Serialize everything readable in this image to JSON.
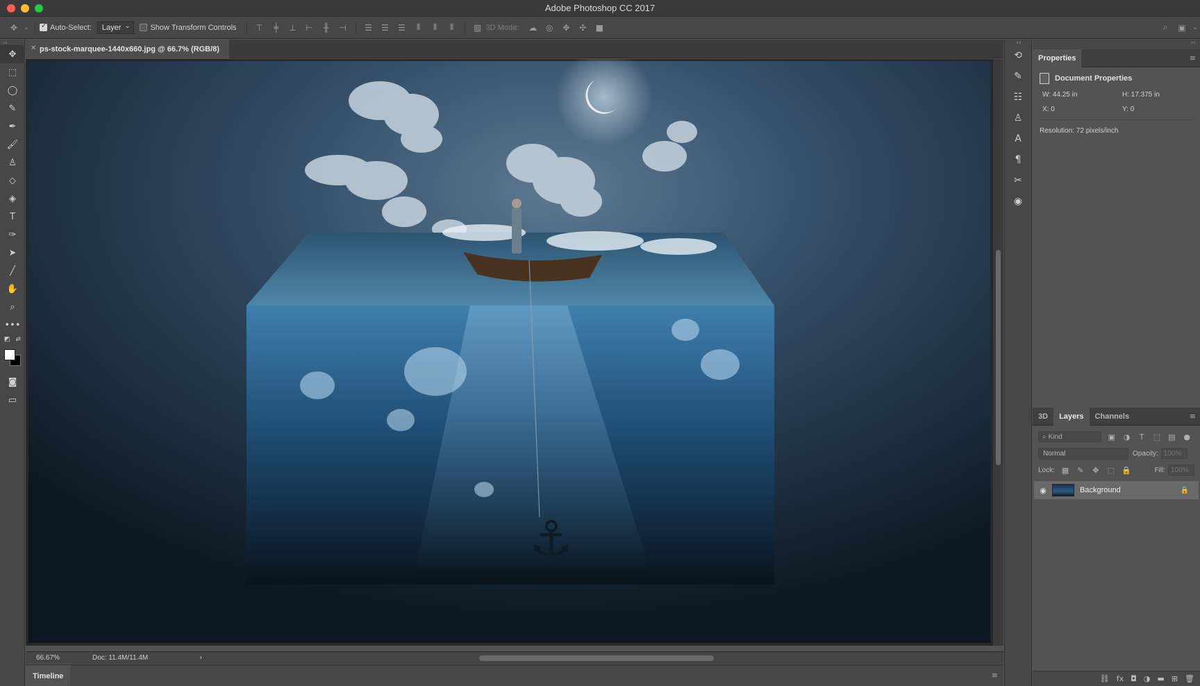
{
  "app": {
    "window_title": "Adobe Photoshop CC 2017"
  },
  "options_bar": {
    "auto_select_label": "Auto-Select:",
    "auto_select_checked": true,
    "auto_select_value": "Layer",
    "show_transform_label": "Show Transform Controls",
    "show_transform_checked": false,
    "mode_3d_label": "3D Mode:"
  },
  "tools": [
    "move-tool",
    "marquee-tool",
    "lasso-tool",
    "quick-selection-tool",
    "eyedropper-tool",
    "brush-tool",
    "clone-stamp-tool",
    "eraser-tool",
    "paint-bucket-tool",
    "type-tool",
    "pen-tool",
    "path-selection-tool",
    "line-tool",
    "hand-tool",
    "zoom-tool",
    "more-tools"
  ],
  "document": {
    "tab_title": "ps-stock-marquee-1440x660.jpg @ 66.7% (RGB/8)",
    "zoom": "66.67%",
    "doc_size": "Doc: 11.4M/11.4M"
  },
  "timeline": {
    "label": "Timeline"
  },
  "properties": {
    "tab_label": "Properties",
    "section_title": "Document Properties",
    "width_label": "W:",
    "width_value": "44.25 in",
    "height_label": "H:",
    "height_value": "17.375 in",
    "x_label": "X:",
    "x_value": "0",
    "y_label": "Y:",
    "y_value": "0",
    "resolution": "Resolution: 72 pixels/inch"
  },
  "layers_panel": {
    "tabs": [
      "3D",
      "Layers",
      "Channels"
    ],
    "active_tab": "Layers",
    "kind_placeholder": "Kind",
    "blend_mode": "Normal",
    "opacity_label": "Opacity:",
    "opacity_value": "100%",
    "lock_label": "Lock:",
    "fill_label": "Fill:",
    "fill_value": "100%",
    "layers": [
      {
        "name": "Background",
        "visible": true,
        "locked": true
      }
    ]
  },
  "colors": {
    "foreground": "#ffffff",
    "background": "#000000",
    "ui_dark": "#474747",
    "ui_mid": "#535353"
  }
}
